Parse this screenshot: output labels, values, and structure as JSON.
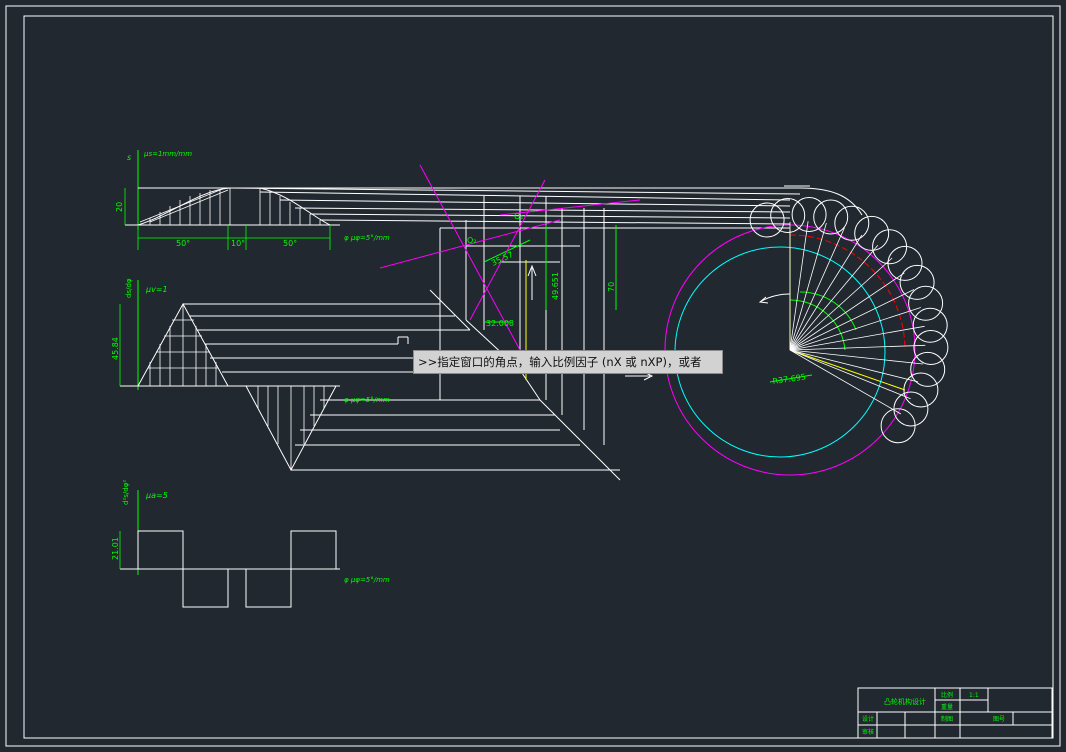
{
  "command_prompt": ">>指定窗口的角点，输入比例因子 (nX 或 nXP)，或者",
  "colors": {
    "background": "#212830",
    "line": "#ffffff",
    "annotation": "#00ff00",
    "magenta": "#ff00ff",
    "cyan": "#00ffff",
    "yellow": "#ffff00",
    "red": "#ff0000",
    "prompt_bg": "#d2d2d2"
  },
  "diagram1": {
    "axis_label": "s",
    "scale_label": "μs=1mm/mm",
    "height_dim": "20",
    "dim_left": "50°",
    "dim_mid": "10°",
    "dim_right": "50°",
    "angle_scale": "φ  μφ=5°/mm"
  },
  "diagram2": {
    "axis_label": "ds/dφ",
    "scale_label": "μv=1",
    "height_dim": "45.84",
    "angle_scale": "φ  μφ=5°/mm"
  },
  "diagram3": {
    "axis_label": "d²s/dφ²",
    "scale_label": "μa=5",
    "height_dim": "21.01",
    "angle_scale": "φ  μφ=5°/mm"
  },
  "construction": {
    "label_o2": "O₂",
    "label_o1": "O₁",
    "dim_1": "35.57",
    "dim_2": "32.008",
    "dim_3": "49.651",
    "dim_4": "70",
    "radius_label": "R37.695"
  },
  "title_block": {
    "drawing_name": "凸轮机构设计",
    "ratio_label": "比例",
    "ratio_value": "1:1",
    "weight_label": "重量",
    "design_label": "设计",
    "drawn_label": "制图",
    "sheet_label": "图号",
    "check_label": "审核"
  }
}
